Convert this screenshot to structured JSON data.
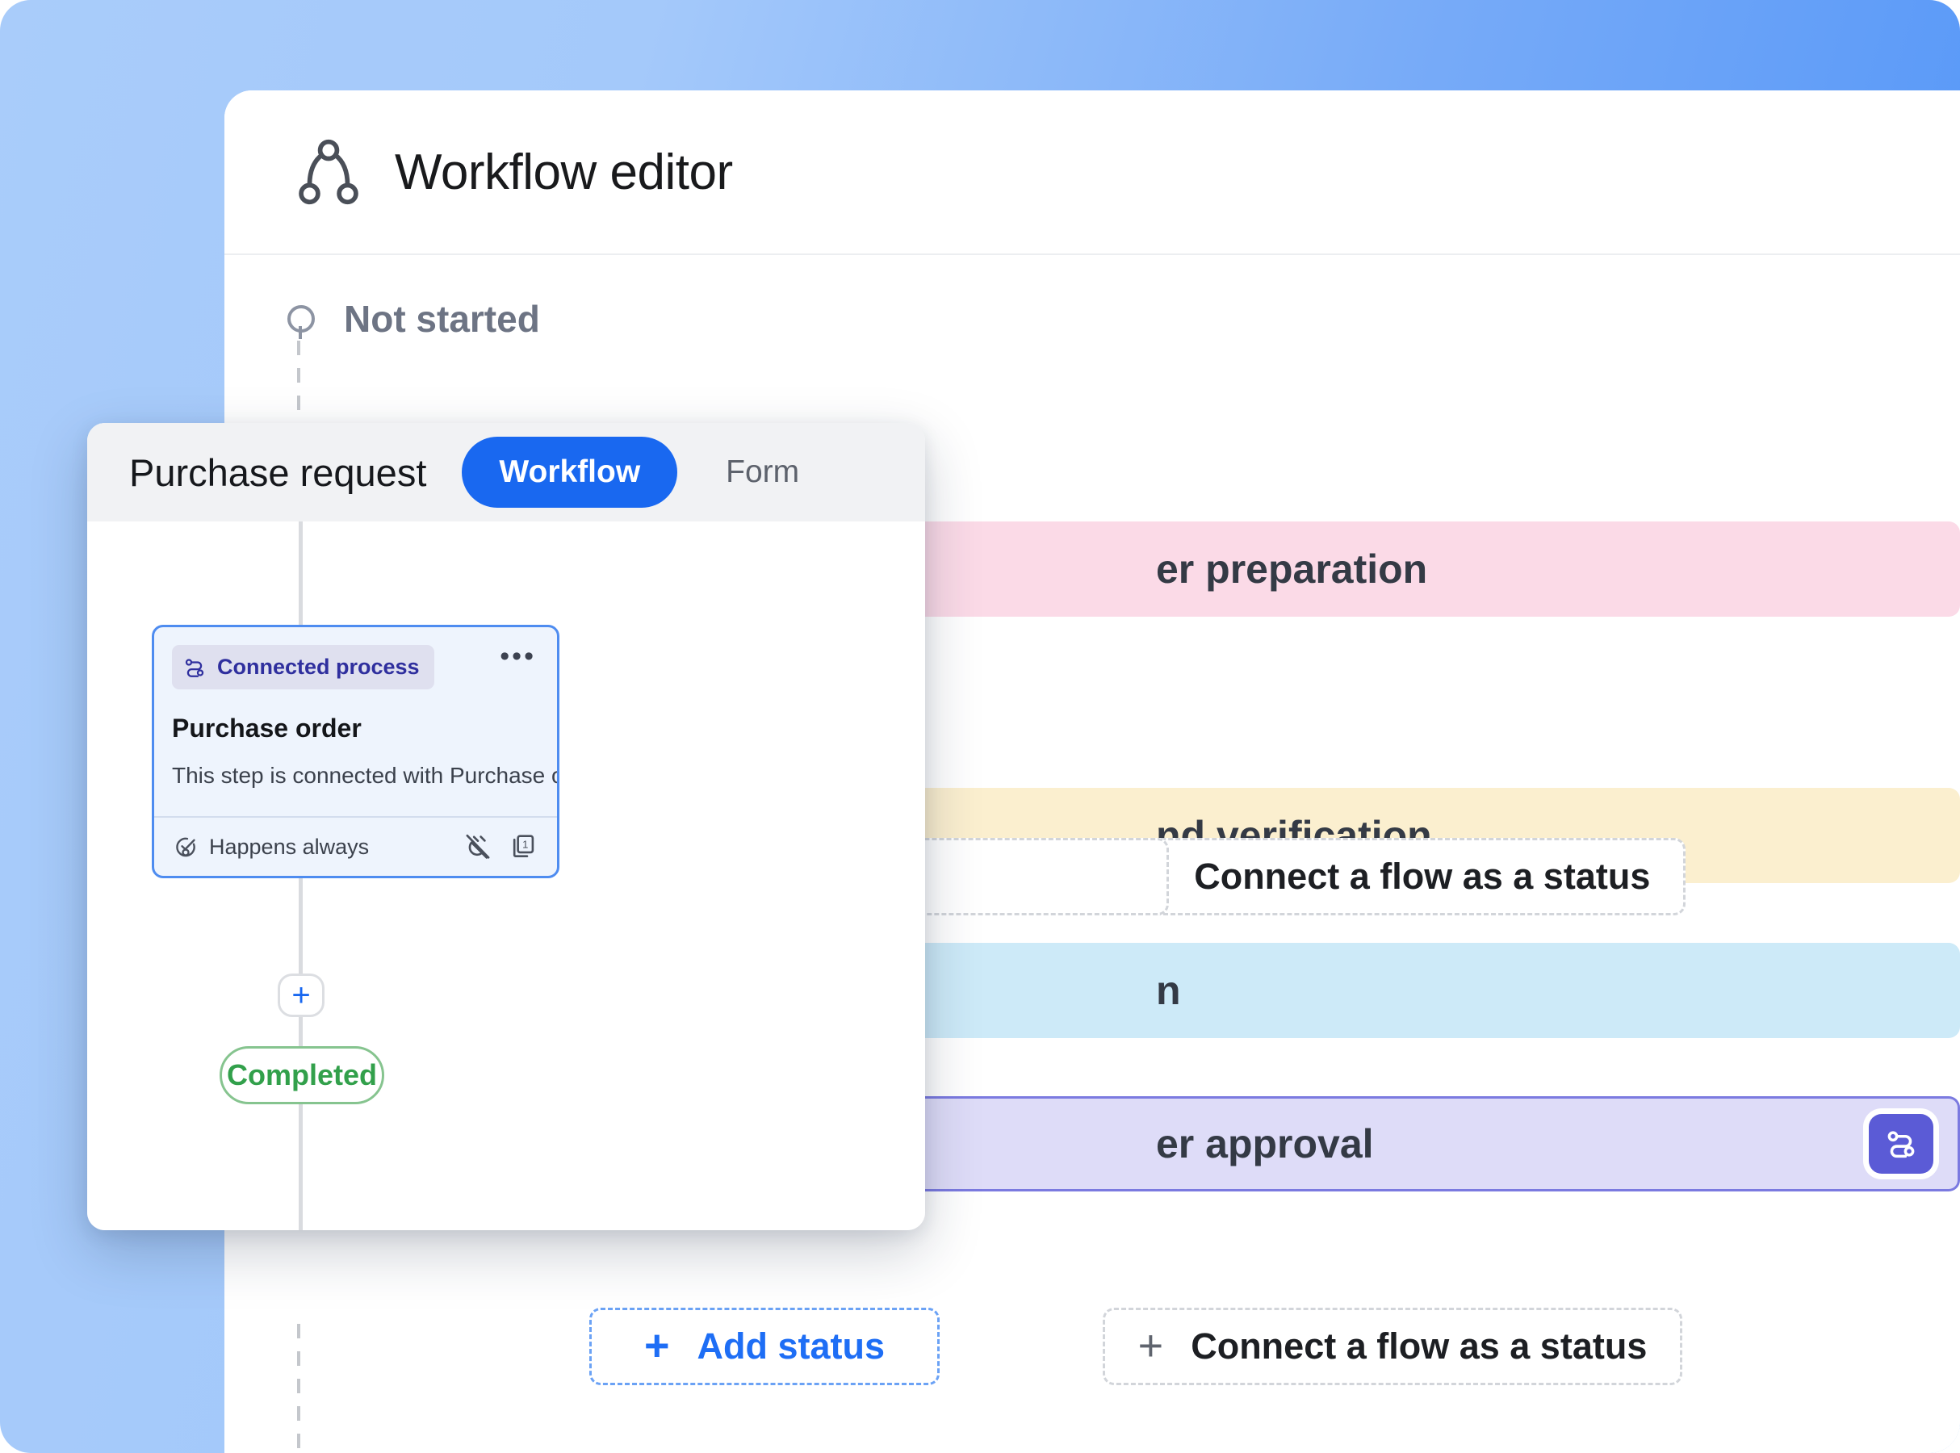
{
  "app": {
    "title": "Workflow editor",
    "icon": "workflow-branch-icon"
  },
  "canvas": {
    "start_node": {
      "label": "Not started",
      "icon": "circle-outline-icon"
    },
    "status_bars": [
      {
        "label": "er preparation",
        "full_label": "Order preparation",
        "color": "#fbdae7",
        "id": "order-preparation"
      },
      {
        "label": "nd verification",
        "full_label": "Fund verification",
        "color": "#fbefcf",
        "id": "fund-verification"
      },
      {
        "label": "n",
        "full_label": "Execution",
        "color": "#cdeaf8",
        "id": "execution"
      },
      {
        "label": "er approval",
        "full_label": "Order approval",
        "color": "#dedcf8",
        "id": "order-approval",
        "border_color": "#7b7ae0",
        "action": {
          "icon": "flow-route-icon",
          "color": "#5b5bd6"
        }
      }
    ],
    "connect_flow_button": {
      "label": "Connect a flow as a status",
      "plus": "+"
    },
    "add_status_button": {
      "label": "Add status",
      "plus": "+"
    }
  },
  "modal": {
    "title": "Purchase request",
    "tabs": [
      {
        "label": "Workflow",
        "active": true
      },
      {
        "label": "Form",
        "active": false
      }
    ],
    "process_card": {
      "badge": {
        "label": "Connected process",
        "icon": "flow-route-icon",
        "text_color": "#2f2f9e",
        "bg_color": "#dfe0ef"
      },
      "menu_icon": "•••",
      "name": "Purchase order",
      "description": "This step is connected with Purchase order flow",
      "footer": {
        "condition_icon": "check-circle-icon",
        "condition_label": "Happens always",
        "icons": [
          {
            "name": "plug-disconnected-icon"
          },
          {
            "name": "stacked-cards-icon",
            "badge": "1"
          }
        ]
      },
      "border_color": "#4e8cf0",
      "bg_color": "#eef4fd"
    },
    "add_node_button": {
      "label": "+"
    },
    "completed_pill": {
      "label": "Completed",
      "color": "#32a04b"
    }
  },
  "theme": {
    "accent_blue": "#1968f0",
    "gradient_from": "#a9ccfa",
    "gradient_to": "#4a90f7"
  }
}
